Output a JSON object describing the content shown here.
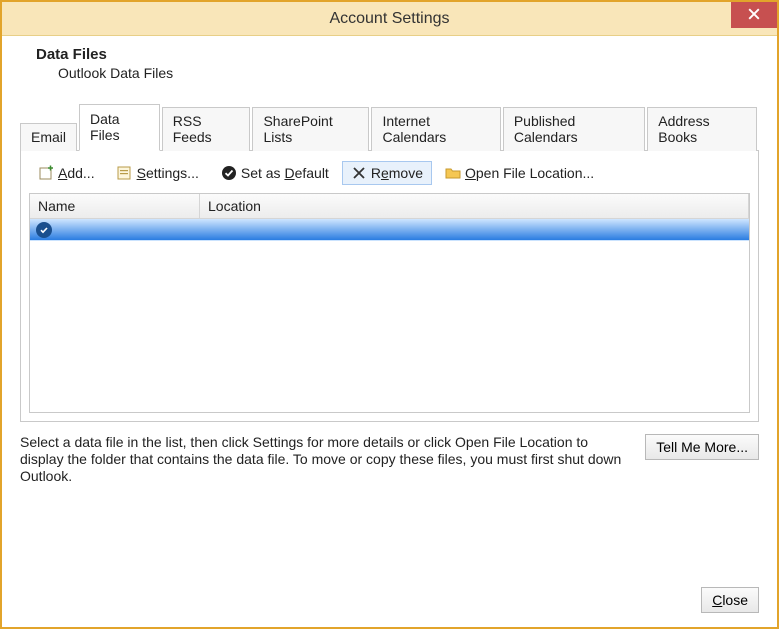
{
  "window": {
    "title": "Account Settings"
  },
  "header": {
    "title": "Data Files",
    "subtitle": "Outlook Data Files"
  },
  "tabs": [
    {
      "label": "Email",
      "active": false
    },
    {
      "label": "Data Files",
      "active": true
    },
    {
      "label": "RSS Feeds",
      "active": false
    },
    {
      "label": "SharePoint Lists",
      "active": false
    },
    {
      "label": "Internet Calendars",
      "active": false
    },
    {
      "label": "Published Calendars",
      "active": false
    },
    {
      "label": "Address Books",
      "active": false
    }
  ],
  "toolbar": {
    "add": "Add...",
    "settings": "Settings...",
    "set_default": "Set as Default",
    "remove": "Remove",
    "open_location": "Open File Location..."
  },
  "columns": {
    "name": "Name",
    "location": "Location"
  },
  "rows": [
    {
      "name": "",
      "location": "",
      "default": true,
      "selected": true
    }
  ],
  "help_text": "Select a data file in the list, then click Settings for more details or click Open File Location to display the folder that contains the data file. To move or copy these files, you must first shut down Outlook.",
  "tell_me_more": "Tell Me More...",
  "close_label": "Close"
}
